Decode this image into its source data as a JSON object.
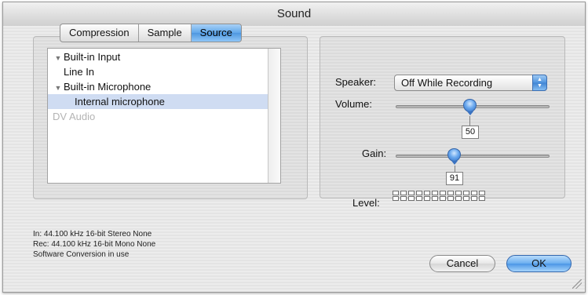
{
  "window": {
    "title": "Sound"
  },
  "tabs": [
    {
      "label": "Compression",
      "selected": false
    },
    {
      "label": "Sample",
      "selected": false
    },
    {
      "label": "Source",
      "selected": true
    }
  ],
  "devices": [
    {
      "label": "Built-in Input",
      "expanded": true,
      "level": 0
    },
    {
      "label": "Line In",
      "level": 1
    },
    {
      "label": "Built-in Microphone",
      "expanded": true,
      "level": 0
    },
    {
      "label": "Internal microphone",
      "level": 1,
      "selected": true
    },
    {
      "label": "DV Audio",
      "level": 0,
      "disabled": true
    }
  ],
  "speaker": {
    "label": "Speaker:",
    "value": "Off While Recording"
  },
  "volume": {
    "label": "Volume:",
    "value": "50",
    "fraction": 0.5
  },
  "gain": {
    "label": "Gain:",
    "value": "91",
    "fraction": 0.37
  },
  "level": {
    "label": "Level:"
  },
  "status": {
    "line1": "In: 44.100 kHz 16-bit Stereo None",
    "line2": "Rec: 44.100 kHz 16-bit Mono None",
    "line3": "Software Conversion in use"
  },
  "buttons": {
    "cancel": "Cancel",
    "ok": "OK"
  },
  "colors": {
    "selection": "#cfdcf2",
    "accent": "#4f97e0"
  }
}
